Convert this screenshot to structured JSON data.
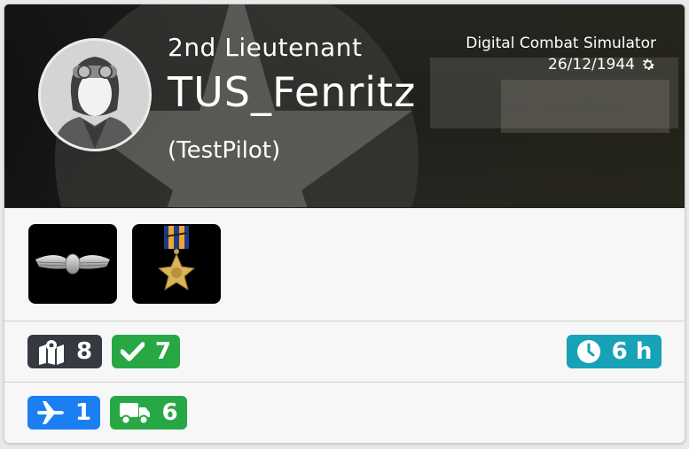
{
  "profile": {
    "rank": "2nd Lieutenant",
    "name": "TUS_Fenritz",
    "squad": "(TestPilot)"
  },
  "server": {
    "name": "Digital Combat Simulator",
    "date": "26/12/1944",
    "icon": "gear-icon"
  },
  "medals": [
    {
      "name": "pilot-wings",
      "icon": "wings-badge"
    },
    {
      "name": "air-medal",
      "icon": "air-medal-ribbon"
    }
  ],
  "stats": {
    "missions": {
      "icon": "map-icon",
      "value": "8",
      "color": "#343a40"
    },
    "completed": {
      "icon": "check-icon",
      "value": "7",
      "color": "#28a745"
    },
    "flight_time": {
      "icon": "clock-icon",
      "value": "6 h",
      "color": "#17a2b8"
    },
    "air_kills": {
      "icon": "plane-icon",
      "value": "1",
      "color": "#1b7ff2"
    },
    "ground_kills": {
      "icon": "truck-icon",
      "value": "6",
      "color": "#28a745"
    }
  }
}
